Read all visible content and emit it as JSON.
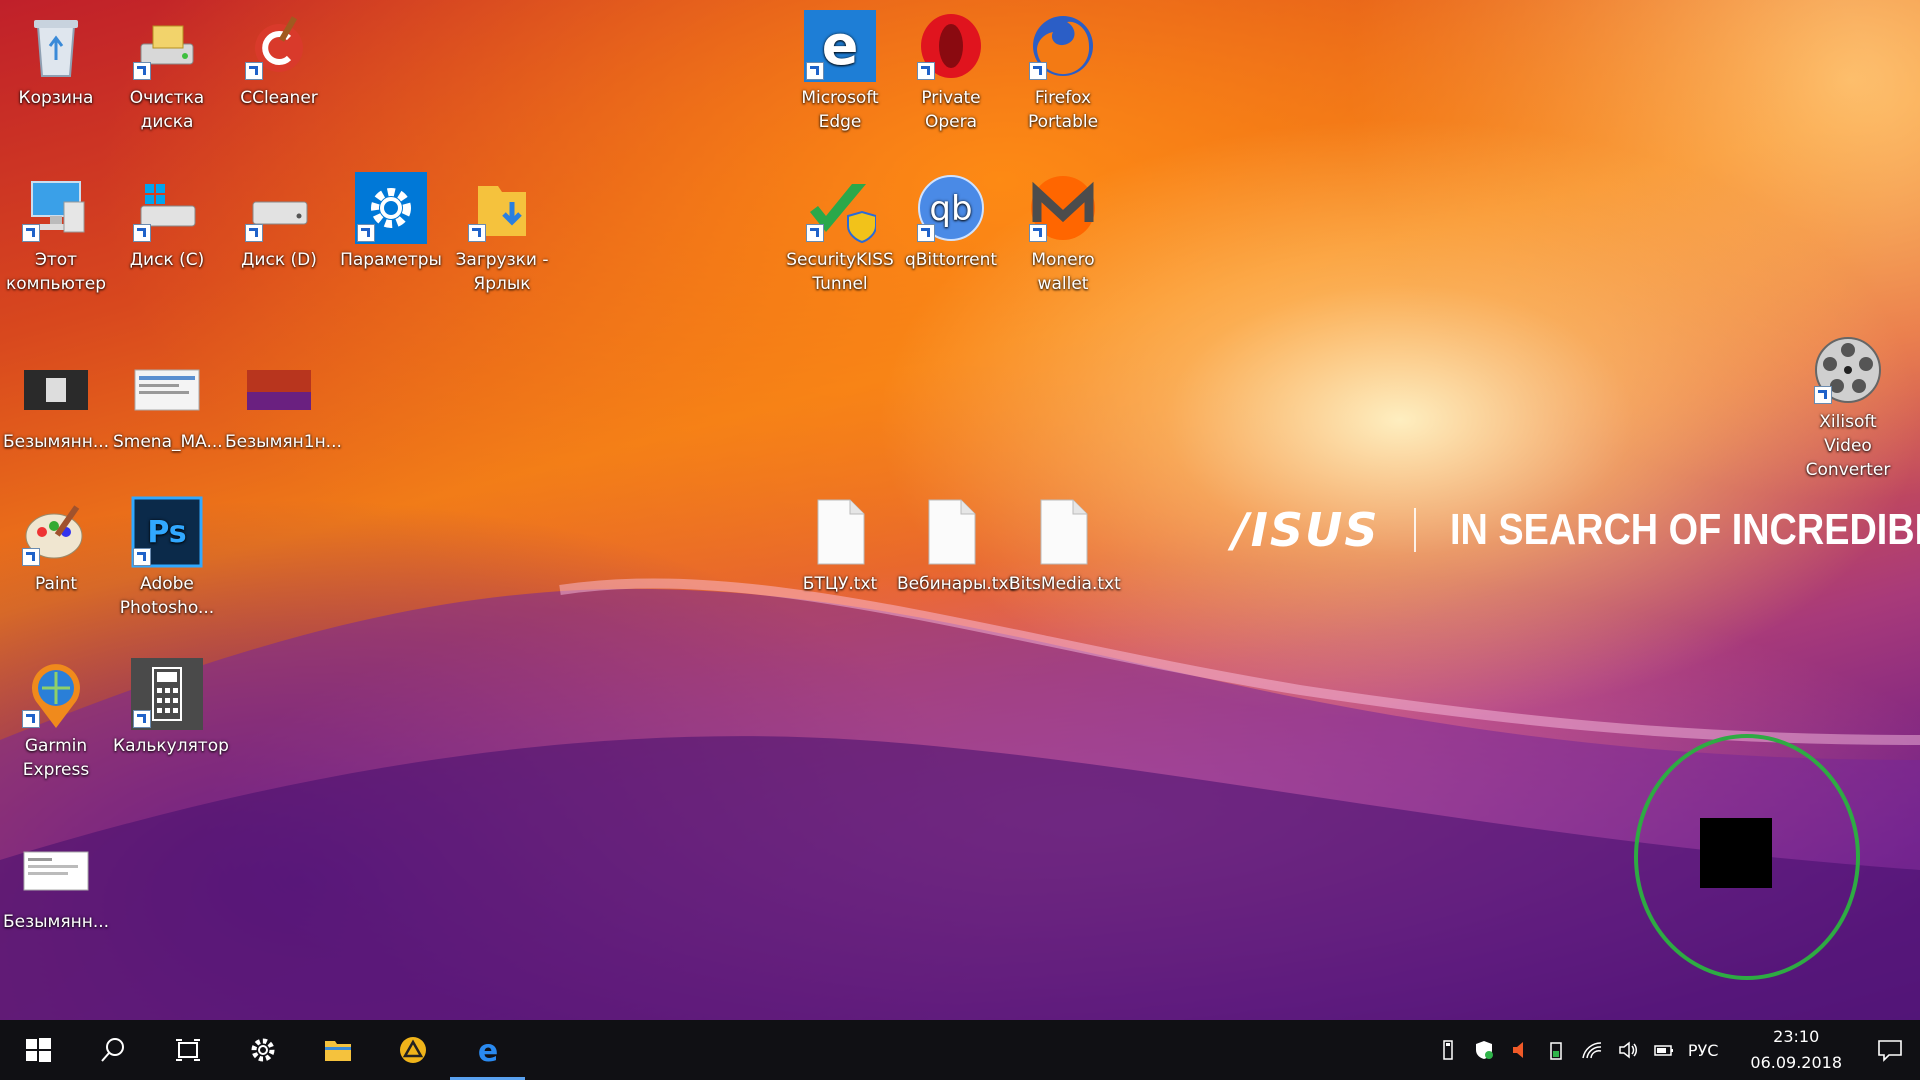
{
  "desktop": {
    "icons": [
      {
        "label": "Корзина",
        "icon": "recycle-bin-icon"
      },
      {
        "label": "Очистка диска",
        "icon": "disk-cleanup-icon"
      },
      {
        "label": "CCleaner",
        "icon": "ccleaner-icon"
      },
      {
        "label": "Этот компьютер",
        "icon": "this-pc-icon"
      },
      {
        "label": "Диск (C)",
        "icon": "drive-c-icon"
      },
      {
        "label": "Диск (D)",
        "icon": "drive-d-icon"
      },
      {
        "label": "Параметры",
        "icon": "settings-gear-icon"
      },
      {
        "label": "Загрузки - Ярлык",
        "icon": "downloads-folder-icon"
      },
      {
        "label": "Безымянн...",
        "icon": "image-thumbnail-icon"
      },
      {
        "label": "Smena_MA...",
        "icon": "image-thumbnail-icon"
      },
      {
        "label": "Безымян1н...",
        "icon": "image-thumbnail-icon"
      },
      {
        "label": "Paint",
        "icon": "paint-icon"
      },
      {
        "label": "Adobe Photosho...",
        "icon": "photoshop-icon"
      },
      {
        "label": "Garmin Express",
        "icon": "garmin-express-icon"
      },
      {
        "label": "Калькулятор",
        "icon": "calculator-icon"
      },
      {
        "label": "Безымянн...",
        "icon": "image-thumbnail-icon"
      },
      {
        "label": "Microsoft Edge",
        "icon": "edge-icon"
      },
      {
        "label": "Private Opera",
        "icon": "opera-icon"
      },
      {
        "label": "Firefox Portable",
        "icon": "firefox-icon"
      },
      {
        "label": "SecurityKISS Tunnel",
        "icon": "securitykiss-icon"
      },
      {
        "label": "qBittorrent",
        "icon": "qbittorrent-icon"
      },
      {
        "label": "Monero wallet",
        "icon": "monero-icon"
      },
      {
        "label": "БТЦУ.txt",
        "icon": "text-file-icon"
      },
      {
        "label": "Вебинары.txt",
        "icon": "text-file-icon"
      },
      {
        "label": "BitsMedia.txt",
        "icon": "text-file-icon"
      },
      {
        "label": "Xilisoft Video Converter",
        "icon": "video-converter-icon"
      }
    ]
  },
  "wallpaper": {
    "brand": "/ISUS",
    "slogan": "IN SEARCH OF INCREDIBLE"
  },
  "colors": {
    "ring": "#2eab43",
    "taskbar": "#101014",
    "accent": "#1f62c9"
  },
  "taskbar": {
    "pinned": [
      "start-icon",
      "search-icon",
      "task-view-icon",
      "settings-icon",
      "file-explorer-icon",
      "app-icon",
      "edge-icon"
    ],
    "active_app": "edge-icon"
  },
  "tray": {
    "language": "РУС",
    "time": "23:10",
    "date": "06.09.2018"
  }
}
